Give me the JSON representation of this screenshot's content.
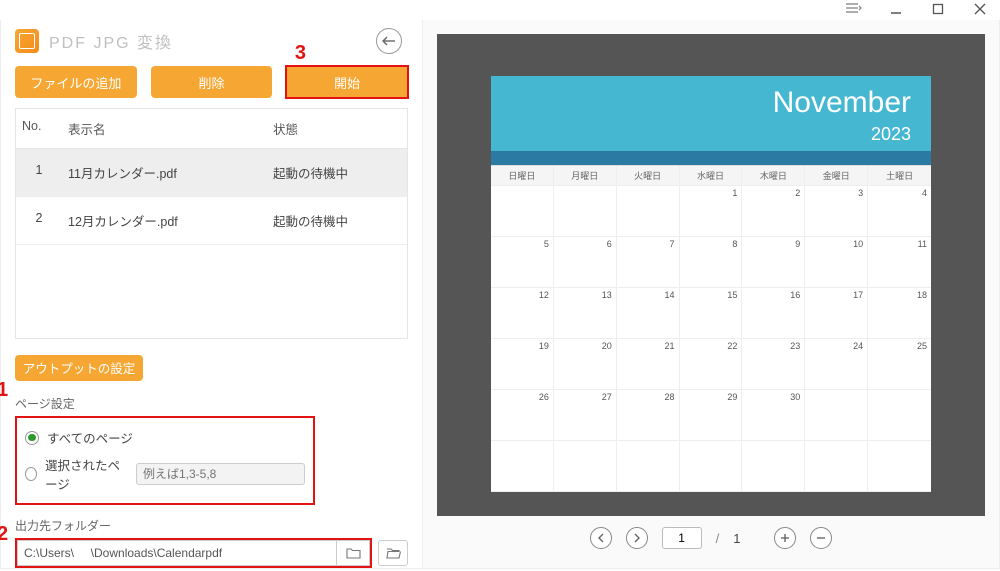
{
  "titlebar": {
    "menu_tooltip": "メニュー",
    "minimize_tooltip": "最小化",
    "maximize_tooltip": "最大化",
    "close_tooltip": "閉じる"
  },
  "app": {
    "title": "PDF JPG 変換"
  },
  "buttons": {
    "add_file": "ファイルの追加",
    "delete": "削除",
    "start": "開始",
    "output_settings": "アウトプットの設定"
  },
  "annotations": {
    "a1": "1",
    "a2": "2",
    "a3": "3"
  },
  "table": {
    "head_no": "No.",
    "head_name": "表示名",
    "head_state": "状態",
    "rows": [
      {
        "no": "1",
        "name": "11月カレンダー.pdf",
        "state": "起動の待機中",
        "selected": true
      },
      {
        "no": "2",
        "name": "12月カレンダー.pdf",
        "state": "起動の待機中",
        "selected": false
      }
    ]
  },
  "page_settings": {
    "label": "ページ設定",
    "opt_all": "すべてのページ",
    "opt_sel": "選択されたページ",
    "placeholder": "例えば1,3-5,8",
    "selected": "all"
  },
  "output_folder": {
    "label": "出力先フォルダー",
    "path": "C:\\Users\\     \\Downloads\\Calendarpdf"
  },
  "preview": {
    "month": "November",
    "year": "2023",
    "dow": [
      "日曜日",
      "月曜日",
      "火曜日",
      "水曜日",
      "木曜日",
      "金曜日",
      "土曜日"
    ],
    "weeks": [
      [
        "",
        "",
        "",
        "1",
        "2",
        "3",
        "4"
      ],
      [
        "5",
        "6",
        "7",
        "8",
        "9",
        "10",
        "11"
      ],
      [
        "12",
        "13",
        "14",
        "15",
        "16",
        "17",
        "18"
      ],
      [
        "19",
        "20",
        "21",
        "22",
        "23",
        "24",
        "25"
      ],
      [
        "26",
        "27",
        "28",
        "29",
        "30",
        "",
        ""
      ],
      [
        "",
        "",
        "",
        "",
        "",
        "",
        ""
      ]
    ]
  },
  "pager": {
    "current": "1",
    "total": "1"
  }
}
